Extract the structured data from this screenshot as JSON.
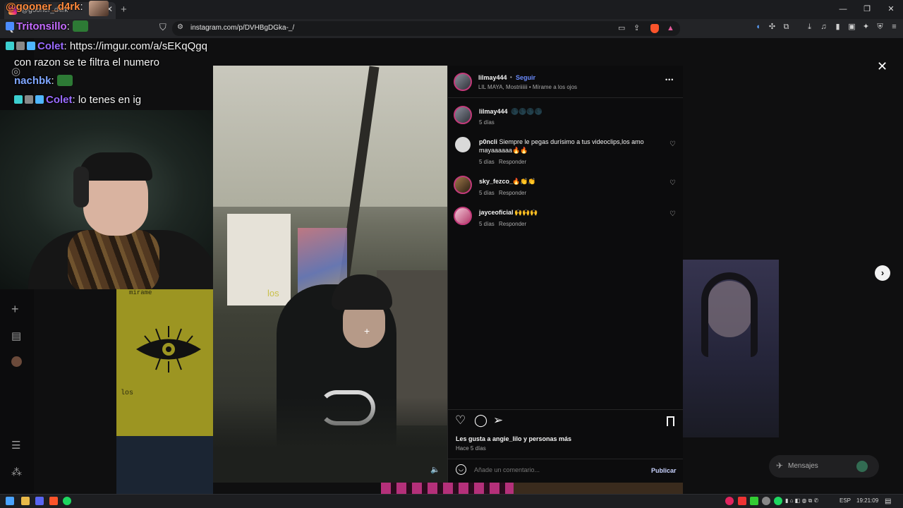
{
  "browser": {
    "tab_title": "@gooner_d4rk",
    "tab_close": "✕",
    "new_tab": "+",
    "url": "instagram.com/p/DVHBgDGka-_/",
    "window_controls": [
      "—",
      "❐",
      "✕"
    ]
  },
  "chat": [
    {
      "user": "@gooner_d4rk",
      "sep": ":",
      "text": "",
      "color": "#ff8a3d"
    },
    {
      "user": "Tritonsillo",
      "sep": ":",
      "text": "",
      "color": "#c46bff"
    },
    {
      "user": "Colet",
      "sep": ": ",
      "text": "https://imgur.com/a/sEKqQgq",
      "color": "#9a6bff"
    },
    {
      "user": "",
      "sep": "",
      "text": "con razon se te filtra el numero",
      "color": "#f5f5f5"
    },
    {
      "user": "nachbk",
      "sep": ":",
      "text": "",
      "color": "#7fa6ff"
    },
    {
      "user": "Colet",
      "sep": ": ",
      "text": "lo tenes en ig",
      "color": "#9a6bff"
    }
  ],
  "album": {
    "top_text": "mirame",
    "bottom_text": "los"
  },
  "media": {
    "overlay_text": "los",
    "mute_icon": "🔈"
  },
  "post": {
    "author": "lilmay444",
    "follow": "Seguir",
    "audio": "LIL MAYA, Mostriiiiii • Mírame a los ojos",
    "caption_user": "lilmay444",
    "caption_text": "🌑🌑🌑🌑",
    "caption_time": "5 días",
    "more_icon": "•••",
    "comments": [
      {
        "user": "p0ncli",
        "text": "Siempre le pegas durísimo a tus videoclips,los amo mayaaaaaa🔥🔥",
        "time": "5 días",
        "reply": "Responder"
      },
      {
        "user": "sky_fezco_",
        "text": "🔥👏👏",
        "time": "5 días",
        "reply": "Responder"
      },
      {
        "user": "jayceoficial",
        "text": "🙌🙌🙌",
        "time": "5 días",
        "reply": "Responder"
      }
    ],
    "likes": "Les gusta a angie_lilo y personas más",
    "posted": "Hace 5 días",
    "comment_placeholder": "Añade un comentario...",
    "publish": "Publicar"
  },
  "messages": {
    "label": "Mensajes"
  },
  "taskbar": {
    "lang": "ESP",
    "time": "19:21:09"
  }
}
